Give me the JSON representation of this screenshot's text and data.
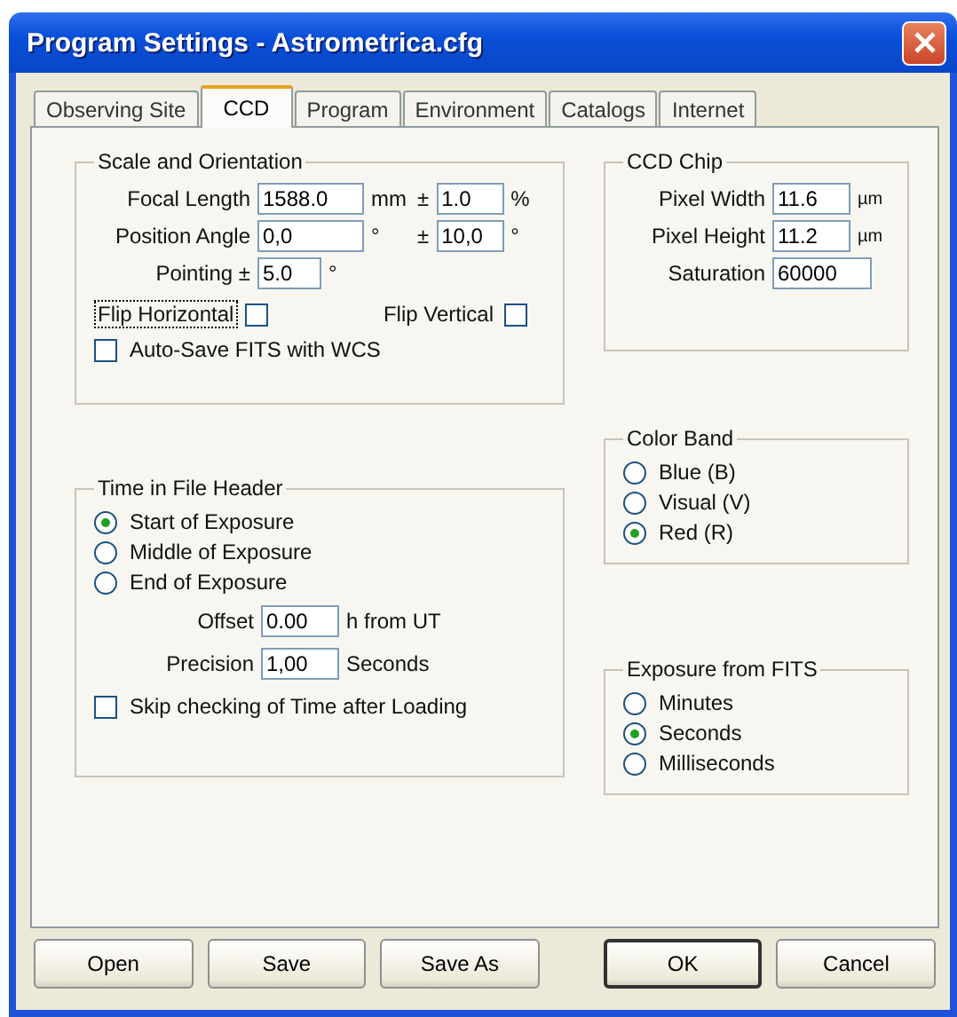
{
  "window": {
    "title": "Program Settings - Astrometrica.cfg"
  },
  "tabs": [
    {
      "label": "Observing Site",
      "selected": false
    },
    {
      "label": "CCD",
      "selected": true
    },
    {
      "label": "Program",
      "selected": false
    },
    {
      "label": "Environment",
      "selected": false
    },
    {
      "label": "Catalogs",
      "selected": false
    },
    {
      "label": "Internet",
      "selected": false
    }
  ],
  "scale_orientation": {
    "title": "Scale and Orientation",
    "rows": [
      {
        "label": "Focal Length",
        "value": "1588.0",
        "unit": "mm",
        "tolerance_sign": "±",
        "tolerance": "1.0",
        "tolerance_unit": "%"
      },
      {
        "label": "Position Angle",
        "value": "0,0",
        "unit": "°",
        "tolerance_sign": "±",
        "tolerance": "10,0",
        "tolerance_unit": "°"
      },
      {
        "label": "Pointing ±",
        "value": "5.0",
        "unit": "°"
      }
    ],
    "flips": [
      {
        "label": "Flip Horizontal",
        "checked": false,
        "focused": true
      },
      {
        "label": "Flip Vertical",
        "checked": false,
        "focused": false
      }
    ],
    "auto_save": {
      "label": "Auto-Save FITS with WCS",
      "checked": false
    }
  },
  "time_in_file_header": {
    "title": "Time in File Header",
    "options": [
      {
        "label": "Start of Exposure",
        "selected": true
      },
      {
        "label": "Middle of Exposure",
        "selected": false
      },
      {
        "label": "End of Exposure",
        "selected": false
      }
    ],
    "fields": [
      {
        "label": "Offset",
        "value": "0.00",
        "unit": "h from UT"
      },
      {
        "label": "Precision",
        "value": "1,00",
        "unit": "Seconds"
      }
    ],
    "skip_check": {
      "label": "Skip checking of Time after Loading",
      "checked": false
    }
  },
  "ccd_chip": {
    "title": "CCD Chip",
    "fields": [
      {
        "label": "Pixel Width",
        "value": "11.6",
        "unit": "µm"
      },
      {
        "label": "Pixel Height",
        "value": "11.2",
        "unit": "µm"
      },
      {
        "label": "Saturation",
        "value": "60000"
      }
    ]
  },
  "color_band": {
    "title": "Color Band",
    "options": [
      {
        "label": "Blue (B)",
        "selected": false
      },
      {
        "label": "Visual (V)",
        "selected": false
      },
      {
        "label": "Red (R)",
        "selected": true
      }
    ]
  },
  "exposure_from_fits": {
    "title": "Exposure from FITS",
    "options": [
      {
        "label": "Minutes",
        "selected": false
      },
      {
        "label": "Seconds",
        "selected": true
      },
      {
        "label": "Milliseconds",
        "selected": false
      }
    ]
  },
  "buttons": [
    {
      "label": "Open",
      "default": false
    },
    {
      "label": "Save",
      "default": false
    },
    {
      "label": "Save As",
      "default": false
    },
    {
      "label": "OK",
      "default": true
    },
    {
      "label": "Cancel",
      "default": false
    }
  ]
}
